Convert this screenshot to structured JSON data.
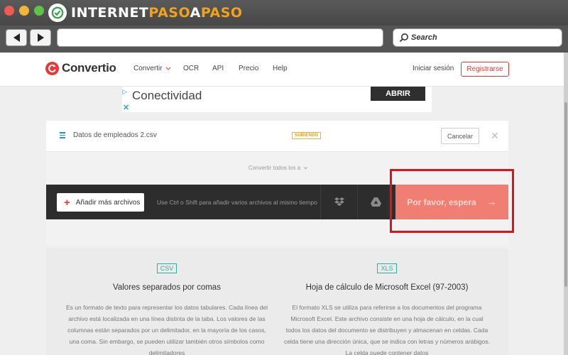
{
  "window": {
    "brand": {
      "part1": "INTERNET",
      "part2": "PASO",
      "part3": "A",
      "part4": "PASO"
    },
    "search_placeholder": "Search"
  },
  "site": {
    "logo": "Convertio",
    "menu": [
      "Convertir",
      "OCR",
      "API",
      "Precio",
      "Help"
    ],
    "login": "Iniciar sesión",
    "register": "Registrarse"
  },
  "ad": {
    "text": "Conectividad",
    "button": "ABRIR"
  },
  "file": {
    "name": "Datos de empleados 2.csv",
    "status": "SUBIENDO",
    "cancel": "Cancelar"
  },
  "convert_all": "Convertir todos los a",
  "actions": {
    "add": "Añadir más archivos",
    "hint": "Use Ctrl o Shift para añadir varios archivos al mismo tiempo",
    "submit": "Por favor, espera"
  },
  "formats": [
    {
      "badge": "CSV",
      "title": "Valores separados por comas",
      "desc": "Es un formato de texto para representar los datos tabulares. Cada línea del archivo está localizada en una línea distinta de la taba. Los valores de las columnas están separados por un delimitador, en la mayoría de los casos, una coma. Sin embargo, se pueden utilizar también otros símbolos como delimitadores"
    },
    {
      "badge": "XLS",
      "title": "Hoja de cálculo de Microsoft Excel (97-2003)",
      "desc": "El formato XLS se utiliza para referirse a los documentos del programa Microsoft Excel. Este archivo consiste en una hoja de cálculo, en la cual todos los datos del documento se distribuyen y almacenan en celdas. Cada celda tiene una dirección única, que se indica con letras y números arábigos. La celda puede contener datos"
    }
  ],
  "colors": {
    "accent": "#e53935",
    "highlight": "#e2101c",
    "teal": "#27b3a4"
  }
}
